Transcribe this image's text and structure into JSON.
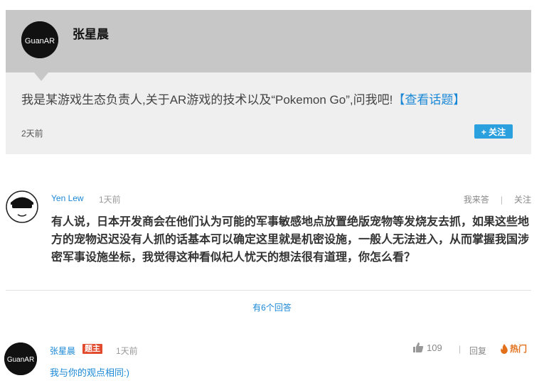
{
  "host": {
    "name": "张星晨",
    "logo_text": "GuanAR",
    "topic_text": "我是某游戏生态负责人,关于AR游戏的技术以及“Pokemon Go”,问我吧!",
    "topic_link": "【查看话题】",
    "time": "2天前",
    "follow_label": "+ 关注"
  },
  "question": {
    "user": "Yen Lew",
    "time": "1天前",
    "actions": {
      "i_answer": "我来答",
      "follow": "关注"
    },
    "text": "有人说，日本开发商会在他们认为可能的军事敏感地点放置绝版宠物等发烧友去抓，如果这些地方的宠物迟迟没有人抓的话基本可以确定这里就是机密设施，一般人无法进入，从而掌握我国涉密军事设施坐标，我觉得这种看似杞人忧天的想法很有道理，你怎么看？"
  },
  "more_answers": "有6个回答",
  "answer": {
    "user": "张星晨",
    "badge": "题主",
    "time": "1天前",
    "likes": "109",
    "reply": "回复",
    "hot": "热门",
    "text": "我与你的观点相同:)"
  },
  "colors": {
    "link": "#1a88d6",
    "follow": "#2aa0de",
    "badge": "#e24a2e",
    "hot": "#e2701a"
  }
}
